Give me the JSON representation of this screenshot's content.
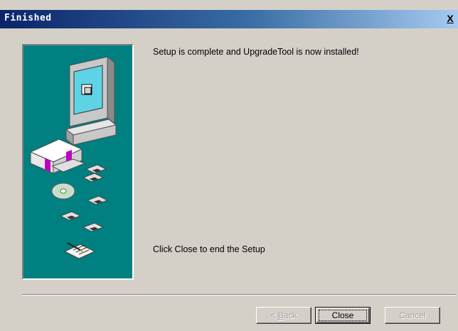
{
  "window": {
    "title": "Finished",
    "close_glyph": "X"
  },
  "content": {
    "message_installed": "Setup is complete and UpgradeTool is now installed!",
    "message_close": "Click Close to end the Setup"
  },
  "buttons": {
    "back": {
      "prefix": "< ",
      "accel": "B",
      "rest": "ack",
      "enabled": false
    },
    "close": {
      "label": "Close",
      "enabled": true,
      "default": true
    },
    "cancel": {
      "label": "Cancel",
      "enabled": false
    }
  },
  "art": {
    "background_color": "#008080",
    "icons": [
      "computer-icon",
      "program-box-icon",
      "floppy-disk-icon",
      "cd-icon",
      "document-pen-icon"
    ]
  },
  "colors": {
    "titlebar_start": "#0a246a",
    "titlebar_end": "#a6caf0",
    "dialog_face": "#d4d0c8"
  }
}
